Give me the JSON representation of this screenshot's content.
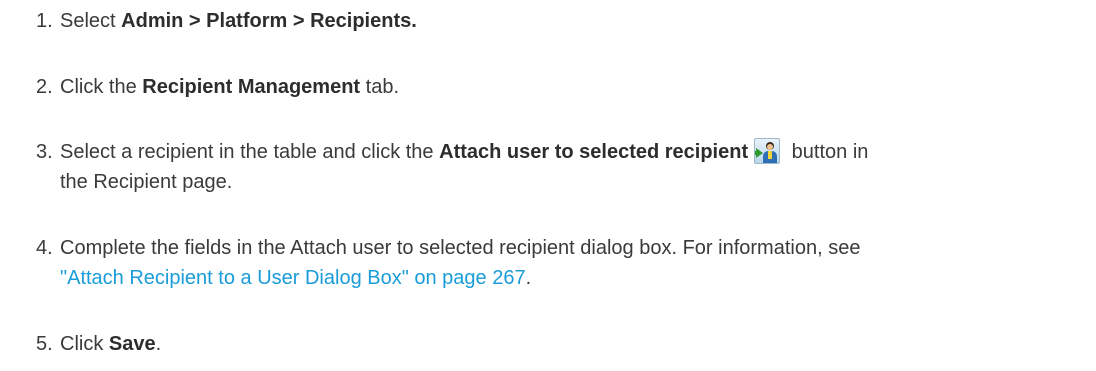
{
  "steps": [
    {
      "number": "1.",
      "pre": "Select ",
      "bold": "Admin > Platform > Recipients.",
      "post": ""
    },
    {
      "number": "2.",
      "pre": "Click the ",
      "bold": "Recipient Management",
      "post": " tab."
    },
    {
      "number": "3.",
      "pre": "Select a recipient in the table and click the ",
      "bold": "Attach user to selected recipient",
      "icon": "attach-user-icon",
      "post": " button in",
      "line2": "the Recipient page."
    },
    {
      "number": "4.",
      "line1": "Complete the fields in the Attach user to selected recipient dialog box. For information, see",
      "link": "\"Attach Recipient to a User Dialog Box\" on page 267",
      "post": "."
    },
    {
      "number": "5.",
      "pre": "Click ",
      "bold": "Save",
      "post": "."
    }
  ],
  "colors": {
    "text": "#3a3a3a",
    "link": "#1a9cd8"
  }
}
